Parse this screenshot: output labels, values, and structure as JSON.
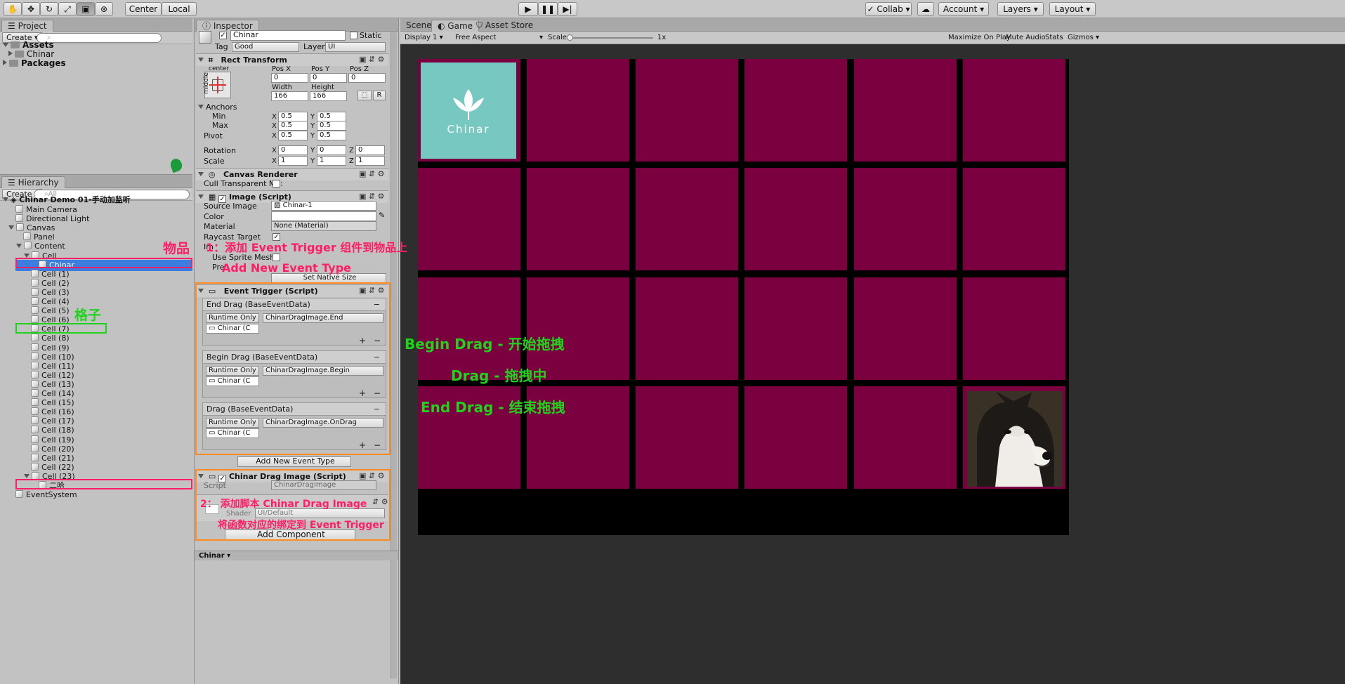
{
  "toolbar": {
    "center_label": "Center",
    "local_label": "Local",
    "collab_label": "Collab",
    "account_label": "Account",
    "layers_label": "Layers",
    "layout_label": "Layout"
  },
  "project": {
    "tab_label": "Project",
    "create_label": "Create",
    "items": [
      "Assets",
      "Chinar",
      "Packages"
    ]
  },
  "hierarchy": {
    "tab_label": "Hierarchy",
    "create_label": "Create",
    "search_placeholder": "All",
    "scene_name": "Chinar Demo 01-手动加监听",
    "items": [
      "Main Camera",
      "Directional Light",
      "Canvas",
      "Panel",
      "Content",
      "Cell",
      "Chinar",
      "Cell (1)",
      "Cell (2)",
      "Cell (3)",
      "Cell (4)",
      "Cell (5)",
      "Cell (6)",
      "Cell (7)",
      "Cell (8)",
      "Cell (9)",
      "Cell (10)",
      "Cell (11)",
      "Cell (12)",
      "Cell (13)",
      "Cell (14)",
      "Cell (15)",
      "Cell (16)",
      "Cell (17)",
      "Cell (18)",
      "Cell (19)",
      "Cell (20)",
      "Cell (21)",
      "Cell (22)",
      "Cell (23)",
      "二哈",
      "EventSystem"
    ]
  },
  "inspector": {
    "tab_label": "Inspector",
    "object_name": "Chinar",
    "static_label": "Static",
    "tag_label": "Tag",
    "tag_value": "Good",
    "layer_label": "Layer",
    "layer_value": "UI",
    "rect": {
      "title": "Rect Transform",
      "anchor_h": "center",
      "anchor_v": "middle",
      "posx_label": "Pos X",
      "posy_label": "Pos Y",
      "posz_label": "Pos Z",
      "posx": "0",
      "posy": "0",
      "posz": "0",
      "width_label": "Width",
      "height_label": "Height",
      "width": "166",
      "height": "166",
      "r_label": "R",
      "anchors_label": "Anchors",
      "min_label": "Min",
      "max_label": "Max",
      "pivot_label": "Pivot",
      "x_label": "X",
      "y_label": "Y",
      "z_label": "Z",
      "min_x": "0.5",
      "min_y": "0.5",
      "max_x": "0.5",
      "max_y": "0.5",
      "pivot_x": "0.5",
      "pivot_y": "0.5",
      "rotation_label": "Rotation",
      "rot_x": "0",
      "rot_y": "0",
      "rot_z": "0",
      "scale_label": "Scale",
      "scale_x": "1",
      "scale_y": "1",
      "scale_z": "1"
    },
    "canvas_renderer": {
      "title": "Canvas Renderer",
      "cull_label": "Cull Transparent Me:"
    },
    "image": {
      "title": "Image (Script)",
      "source_label": "Source Image",
      "source_value": "Chinar-1",
      "color_label": "Color",
      "material_label": "Material",
      "material_value": "None (Material)",
      "raycast_label": "Raycast Target",
      "image_type_label": "Im",
      "sprite_mesh_label": "Use Sprite Mesh",
      "preserve_label": "Pre",
      "native_size_label": "Set Native Size"
    },
    "event_trigger": {
      "title": "Event Trigger (Script)",
      "events": [
        {
          "name": "End Drag (BaseEventData)",
          "mode": "Runtime Only",
          "function": "ChinarDragImage.End",
          "target": "Chinar (C"
        },
        {
          "name": "Begin Drag (BaseEventData)",
          "mode": "Runtime Only",
          "function": "ChinarDragImage.Begin",
          "target": "Chinar (C"
        },
        {
          "name": "Drag (BaseEventData)",
          "mode": "Runtime Only",
          "function": "ChinarDragImage.OnDrag",
          "target": "Chinar (C"
        }
      ],
      "add_event_label": "Add New Event Type"
    },
    "drag_script": {
      "title": "Chinar Drag Image (Script)",
      "script_label": "Script",
      "script_value": "ChinarDragImage",
      "shader_label": "Shader",
      "shader_value": "UI/Default"
    },
    "add_component_label": "Add Component",
    "footer_label": "Chinar"
  },
  "scene": {
    "tabs": [
      "Scene",
      "Game",
      "Asset Store"
    ],
    "display": "Display 1",
    "aspect": "Free Aspect",
    "scale_label": "Scale",
    "scale_value": "1x",
    "maximize": "Maximize On Play",
    "mute": "Mute Audio",
    "stats": "Stats",
    "gizmos": "Gizmos",
    "logo_text": "Chinar"
  },
  "annotations": {
    "item_label": "物品",
    "cell_label": "格子",
    "step1": "1：添加 Event Trigger 组件到物品上",
    "step1_sub": "Add New Event Type",
    "step2": "2：  添加脚本 Chinar Drag Image",
    "step2_sub": "将函数对应的绑定到 Event Trigger",
    "begin": "Begin Drag  -  开始拖拽",
    "drag": "Drag  -  拖拽中",
    "end": "End Drag  -  结束拖拽"
  },
  "colors": {
    "cell": "#7a0040",
    "tile_teal": "#76c8c0",
    "annotation_red": "#ff1e66",
    "annotation_green": "#21d21c",
    "annotation_orange": "#ff8a1f"
  }
}
